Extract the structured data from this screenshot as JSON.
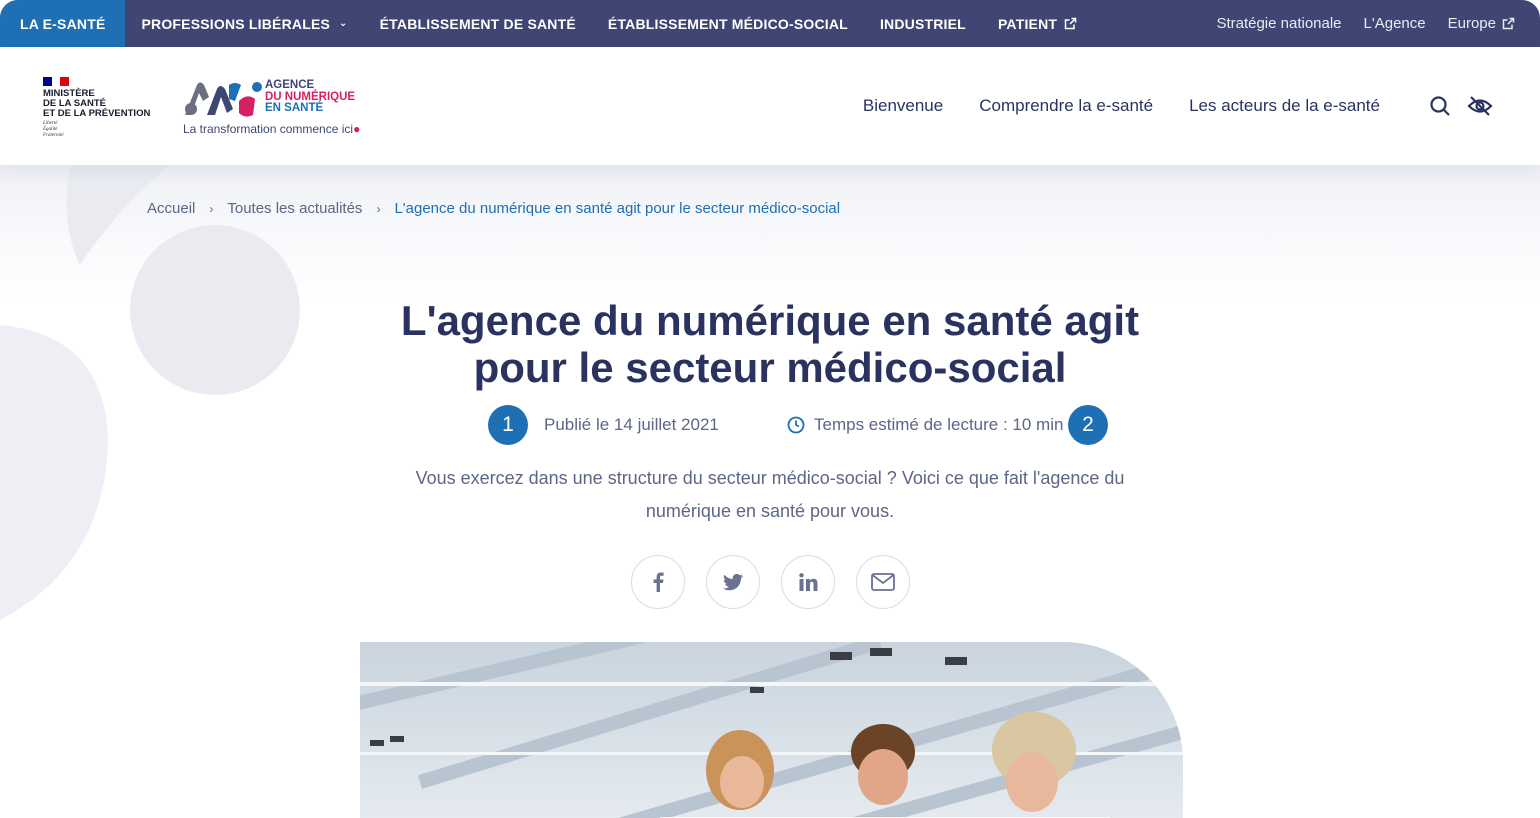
{
  "topbar": {
    "tabs": [
      {
        "label": "LA E-SANTÉ",
        "active": true
      },
      {
        "label": "PROFESSIONS LIBÉRALES",
        "has_dropdown": true
      },
      {
        "label": "ÉTABLISSEMENT DE SANTÉ"
      },
      {
        "label": "ÉTABLISSEMENT MÉDICO-SOCIAL"
      },
      {
        "label": "INDUSTRIEL"
      },
      {
        "label": "PATIENT",
        "external": true
      }
    ],
    "right_links": [
      {
        "label": "Stratégie nationale"
      },
      {
        "label": "L'Agence"
      },
      {
        "label": "Europe",
        "external": true
      }
    ]
  },
  "header": {
    "ministere": {
      "line1": "MINISTÈRE",
      "line2": "DE LA SANTÉ",
      "line3": "ET DE LA PRÉVENTION",
      "devise1": "Liberté",
      "devise2": "Égalité",
      "devise3": "Fraternité"
    },
    "ans": {
      "word1": "AGENCE",
      "word2": "DU NUMÉRIQUE",
      "word3": "EN SANTÉ",
      "tagline": "La transformation commence ici"
    },
    "nav": [
      "Bienvenue",
      "Comprendre la e-santé",
      "Les acteurs de la e-santé"
    ],
    "icons": {
      "search": "search-icon",
      "accessibility": "eye-slash-icon"
    }
  },
  "breadcrumb": {
    "items": [
      "Accueil",
      "Toutes les actualités"
    ],
    "current": "L'agence du numérique en santé agit pour le secteur médico-social",
    "separator": "›"
  },
  "article": {
    "title_line1": "L'agence du numérique en santé agit",
    "title_line2": "pour le secteur médico-social",
    "badge1": "1",
    "badge2": "2",
    "published": "Publié le 14 juillet 2021",
    "reading_time": "Temps estimé de lecture : 10 min",
    "lead_line1": "Vous exercez dans une structure du secteur médico-social ? Voici ce que fait l'agence du",
    "lead_line2": "numérique en santé pour vous."
  },
  "share": [
    "facebook-icon",
    "twitter-icon",
    "linkedin-icon",
    "mail-icon"
  ],
  "colors": {
    "navy": "#3f4673",
    "blue": "#1f6fb5",
    "pink": "#d61f64",
    "text": "#2a3360",
    "muted": "#5d6588",
    "flag_blue": "#000091",
    "flag_red": "#e1000f"
  }
}
